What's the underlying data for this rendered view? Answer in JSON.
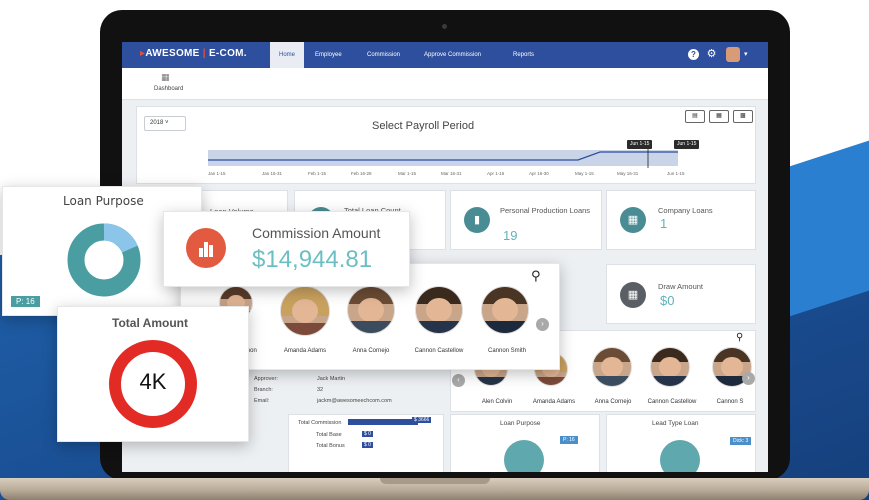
{
  "nav": {
    "brand_a": "AWESOME",
    "brand_b": "E-COM.",
    "items": [
      "Home",
      "Employee",
      "Commission",
      "Approve Commission",
      "Reports"
    ],
    "help_icon": "?",
    "gear_icon": "⚙",
    "caret": "▾"
  },
  "subbar": {
    "dashboard_label": "Dashboard"
  },
  "payroll": {
    "year": "2018",
    "year_caret": "˅",
    "title": "Select Payroll Period",
    "ticks": [
      "Jan 1-15",
      "Jan 16-31",
      "Feb 1-15",
      "Feb 16-28",
      "Mar 1-15",
      "Mar 16-31",
      "Apr 1-15",
      "Apr 16-30",
      "May 1-15",
      "May 16-31",
      "Jun 1-15"
    ],
    "tags": [
      "Jun 1-15",
      "Jun 1-15"
    ]
  },
  "cards": {
    "loan_volume_label": "Loan Volume",
    "loan_count_label": "Total Loan Count",
    "personal_production_label": "Personal Production Loans",
    "personal_production_value": "19",
    "company_loans_label": "Company Loans",
    "company_loans_value": "1",
    "draw_amount_label": "Draw Amount",
    "draw_amount_value": "$0"
  },
  "commission_card": {
    "label": "Commission Amount",
    "value": "$14,944.81"
  },
  "loan_purpose_card": {
    "title": "Loan Purpose",
    "badge": "P: 16"
  },
  "total_amount_card": {
    "title": "Total Amount",
    "value": "4K"
  },
  "people_popup": {
    "names": [
      "Aaron Colvin",
      "Amanda Adams",
      "Anna Cornejo",
      "Cannon Castellow",
      "Cannon Smith"
    ],
    "partial_name": "mon",
    "search_icon": "⚲",
    "next_icon": "›"
  },
  "people_panel": {
    "names": [
      "Alen Colvin",
      "Amanda Adams",
      "Anna Cornejo",
      "Cannon Castellow",
      "Cannon S"
    ],
    "prev_icon": "‹",
    "next_icon": "›"
  },
  "details": {
    "approver_label": "Approver:",
    "approver_value": "Jack Martin",
    "branch_label": "Branch:",
    "branch_value": "32",
    "email_label": "Email:",
    "email_value": "jackm@awesomeechcom.com"
  },
  "commission_table": {
    "title": "Total Commission",
    "bar_value": "$ 3666",
    "row1_label": "Total Base",
    "row1_value": "$ 0",
    "row2_label": "Total Bonus",
    "row2_value": "$ 0"
  },
  "bottom_cards": {
    "loan_purpose_title": "Loan Purpose",
    "loan_purpose_badge": "P: 16",
    "lead_type_title": "Lead Type Loan",
    "lead_type_badge": "Dick: 3"
  }
}
